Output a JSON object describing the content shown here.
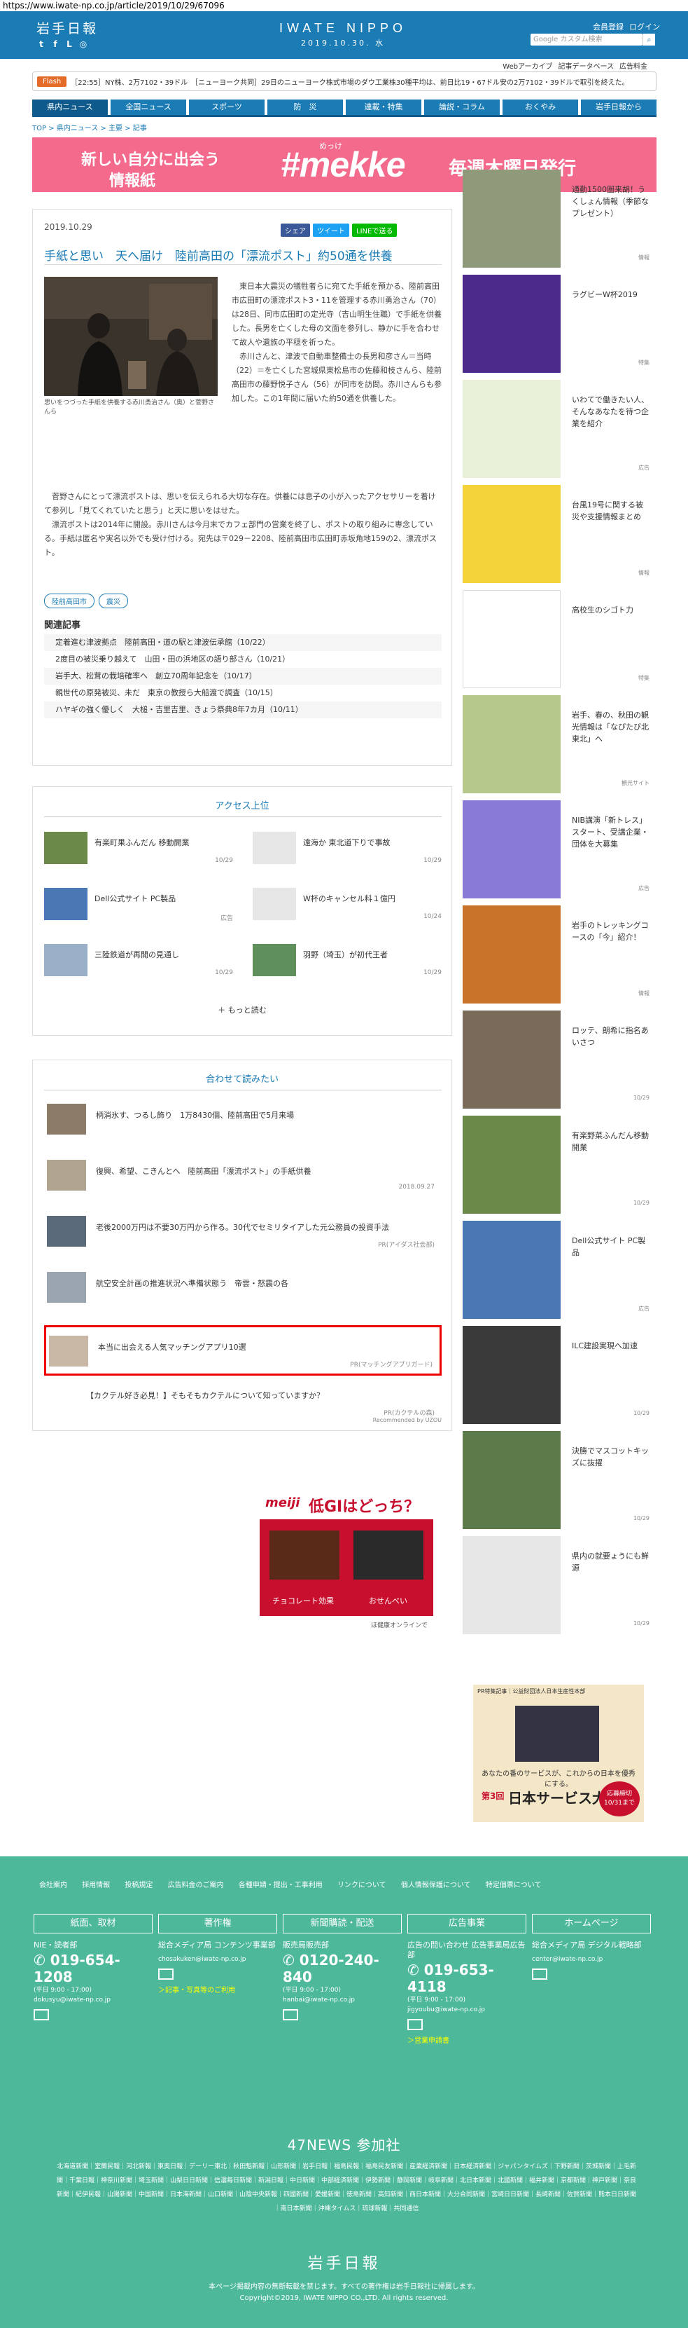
{
  "url": "https://www.iwate-np.co.jp/article/2019/10/29/67096",
  "header": {
    "logo": "岩手日報",
    "brand_en": "IWATE NIPPO",
    "brand_date": "2019.10.30. 水",
    "user_links": [
      "会員登録",
      "ログイン"
    ],
    "search_placeholder": "Google カスタム検索",
    "sub_links": [
      "Webアーカイブ",
      "記事データベース",
      "広告料金"
    ]
  },
  "flash": {
    "tag": "Flash",
    "text": "［22:55］NY株、2万7102・39ドル　［ニューヨーク共同］29日のニューヨーク株式市場のダウ工業株30種平均は、前日比19・67ドル安の2万7102・39ドルで取引を終えた。"
  },
  "nav": [
    "県内ニュース",
    "全国ニュース",
    "スポーツ",
    "防　災",
    "連載・特集",
    "論説・コラム",
    "おくやみ",
    "岩手日報から"
  ],
  "breadcrumb": "TOP > 県内ニュース > 主要 > 記事",
  "banner": {
    "line1": "新しい自分に出会う",
    "line2": "情報紙",
    "ruby": "めっけ",
    "hash": "#mekke",
    "right": "毎週木曜日発行"
  },
  "article": {
    "date": "2019.10.29",
    "share": [
      "シェア",
      "ツイート",
      "LINEで送る"
    ],
    "title": "手紙と思い　天へ届け　陸前高田の「漂流ポスト」約50通を供養",
    "caption": "思いをつづった手紙を供養する赤川勇治さん（奥）と菅野さんら",
    "body1": "　東日本大震災の犠牲者らに宛てた手紙を預かる、陸前高田市広田町の漂流ポスト3・11を管理する赤川勇治さん（70）は28日、同市広田町の定光寺（吉山明生住職）で手紙を供養した。長男を亡くした母の文面を参列し、静かに手を合わせて故人や遺族の平穏を祈った。\n　赤川さんと、津波で自動車整備士の長男和彦さん＝当時（22）＝を亡くした宮城県東松島市の佐藤和枝さんら、陸前高田市の藤野悦子さん（56）が同市を訪問。赤川さんらも参加した。この1年間に届いた約50通を供養した。",
    "body2": "　菅野さんにとって漂流ポストは、思いを伝えられる大切な存在。供養には息子の小が入ったアクセサリーを着けて参列し「見てくれていたと思う」と天に思いをはせた。\n　漂流ポストは2014年に開設。赤川さんは今月末でカフェ部門の営業を終了し、ポストの取り組みに専念している。手紙は匿名や実名以外でも受け付ける。宛先は〒029－2208、陸前高田市広田町赤坂角地159の2、漂流ポスト。",
    "tags": [
      "陸前高田市",
      "震災"
    ],
    "related_heading": "関連記事",
    "related": [
      "定着進む津波拠点　陸前高田・道の駅と津波伝承館（10/22）",
      "2度目の被災乗り越えて　山田・田の浜地区の語り部さん（10/21）",
      "岩手大、松茸の栽培確率へ　創立70周年記念を（10/17）",
      "親世代の原発被災、未だ　東京の教授ら大船渡で調査（10/15）",
      "ハヤギの強く優しく　大槌・吉里吉里、きょう祭典8年7カ月（10/11）"
    ]
  },
  "access": {
    "heading": "アクセス上位",
    "items": [
      {
        "title": "有楽町果ふんだん 移動開業",
        "date": "10/29"
      },
      {
        "title": "遠海か 東北道下りで事故",
        "date": "10/29"
      },
      {
        "title": "Dell公式サイト PC製品",
        "date": "広告"
      },
      {
        "title": "W杯のキャンセル料１億円",
        "date": "10/24"
      },
      {
        "title": "三陸鉄道が再開の見通し",
        "date": "10/29"
      },
      {
        "title": "羽野（埼玉）が初代王者",
        "date": "10/29"
      }
    ],
    "more": "もっと読む"
  },
  "reco": {
    "heading": "合わせて読みたい",
    "items": [
      {
        "title": "柄消氷す、つるし飾り　1万8430個、陸前高田で5月来場",
        "date": ""
      },
      {
        "title": "復興、希望、こきんとへ　陸前高田「漂流ポスト」の手紙供養",
        "date": "2018.09.27"
      },
      {
        "title": "老後2000万円は不要30万円から作る。30代でセミリタイアした元公務員の投資手法",
        "date": "PR(アイダス社会部)"
      },
      {
        "title": "航空安全計画の推進状況へ準備状態う　帝雲・怒震の各",
        "date": ""
      },
      {
        "title": "本当に出会える人気マッチングアプリ10選",
        "date": "PR(マッチングアプリガード)"
      },
      {
        "title": "【カクテル好き必見！】そもそもカクテルについて知っていますか？",
        "date": "PR(カクテルの森)"
      }
    ],
    "powered": "Recommended by UZOU"
  },
  "ad": {
    "brand": "meiji",
    "headline": "低GIはどっち？",
    "left": "チョコレート効果",
    "right": "おせんべい",
    "note": "ほ健康オンラインで"
  },
  "sidebar": [
    {
      "title": "通勤1500圏来胡！うくしょん情報（季節なプレゼント）",
      "date": "情報"
    },
    {
      "title": "ラグビーW杯2019",
      "date": "特集"
    },
    {
      "title": "いわてで働きたい人、そんなあなたを待つ企業を紹介",
      "date": "広告"
    },
    {
      "title": "台風19号に関する被災や支援情報まとめ",
      "date": "情報"
    },
    {
      "title": "高校生のシゴト力",
      "date": "特集"
    },
    {
      "title": "岩手、春の、秋田の観光情報は「なぴたび北東北」へ",
      "date": "観光サイト"
    },
    {
      "title": "NIB講演「新トレス」スタート、受講企業・団体を大募集",
      "date": "広告"
    },
    {
      "title": "岩手のトレッキングコースの「今」紹介！",
      "date": "情報"
    },
    {
      "title": "ロッテ、朗希に指名あいさつ",
      "date": "10/29"
    },
    {
      "title": "有楽野菜ふんだん移動開業",
      "date": "10/29"
    },
    {
      "title": "Dell公式サイト PC製品",
      "date": "広告"
    },
    {
      "title": "ILC建設実現へ加速",
      "date": "10/29"
    },
    {
      "title": "決勝でマスコットキッズに抜擢",
      "date": "10/29"
    },
    {
      "title": "県内の就要ょうにも鮮源",
      "date": "10/29"
    }
  ],
  "sidead": {
    "top": "PR特集記事｜公益財団法人日本生産性本部",
    "line": "あなたの番のサービスが、これからの日本を優秀にする。",
    "award": "日本サービス大賞",
    "round": "第3回",
    "deadline": "応募締切 10/31まで"
  },
  "footer": {
    "links": [
      "会社案内",
      "採用情報",
      "投稿規定",
      "広告料金のご案内",
      "各種申請・提出・工事利用",
      "リンクについて",
      "個人情報保護について",
      "特定個票について"
    ],
    "cols": [
      {
        "head": "紙面、取材",
        "sub": "NIE・読者部",
        "tel": "019-654-1208",
        "hours": "(平日 9:00 - 17:00)",
        "mail": "dokusyu@iwate-np.co.jp",
        "link": ""
      },
      {
        "head": "著作権",
        "sub": "総合メディア局 コンテンツ事業部",
        "tel": "",
        "hours": "",
        "mail": "chosakuken@iwate-np.co.jp",
        "link": "＞記事・写真等のご利用"
      },
      {
        "head": "新聞購読・配送",
        "sub": "販売局販売部",
        "tel": "0120-240-840",
        "hours": "(平日 9:00 - 17:00)",
        "mail": "hanbai@iwate-np.co.jp",
        "link": ""
      },
      {
        "head": "広告事業",
        "sub": "広告の問い合わせ 広告事業局広告部",
        "tel": "019-653-4118",
        "hours": "(平日 9:00 - 17:00)",
        "mail": "jigyoubu@iwate-np.co.jp",
        "link": "＞営業申請書"
      },
      {
        "head": "ホームページ",
        "sub": "総合メディア局 デジタル戦略部",
        "tel": "",
        "hours": "",
        "mail": "center@iwate-np.co.jp",
        "link": ""
      }
    ],
    "n47": "47NEWS 参加社",
    "papers": "北海道新聞｜室蘭民報｜河北新報｜東奥日報｜デーリー東北｜秋田魁新報｜山形新聞｜岩手日報｜福島民報｜福島民友新聞｜産業経済新聞｜日本経済新聞｜ジャパンタイムズ｜下野新聞｜茨城新聞｜上毛新聞｜千葉日報｜神奈川新聞｜埼玉新聞｜山梨日日新聞｜信濃毎日新聞｜新潟日報｜中日新聞｜中部経済新聞｜伊勢新聞｜静岡新聞｜岐阜新聞｜北日本新聞｜北國新聞｜福井新聞｜京都新聞｜神戸新聞｜奈良新聞｜紀伊民報｜山陽新聞｜中国新聞｜日本海新聞｜山口新聞｜山陰中央新報｜四國新聞｜愛媛新聞｜徳島新聞｜高知新聞｜西日本新聞｜大分合同新聞｜宮崎日日新聞｜長崎新聞｜佐賀新聞｜熊本日日新聞｜南日本新聞｜沖縄タイムス｜琉球新報｜共同通信",
    "logo": "岩手日報",
    "note1": "本ページ掲載内容の無断転載を禁じます。すべての著作権は岩手日報社に帰属します。",
    "note2": "Copyright©2019, IWATE NIPPO CO.,LTD. All rights reserved."
  }
}
